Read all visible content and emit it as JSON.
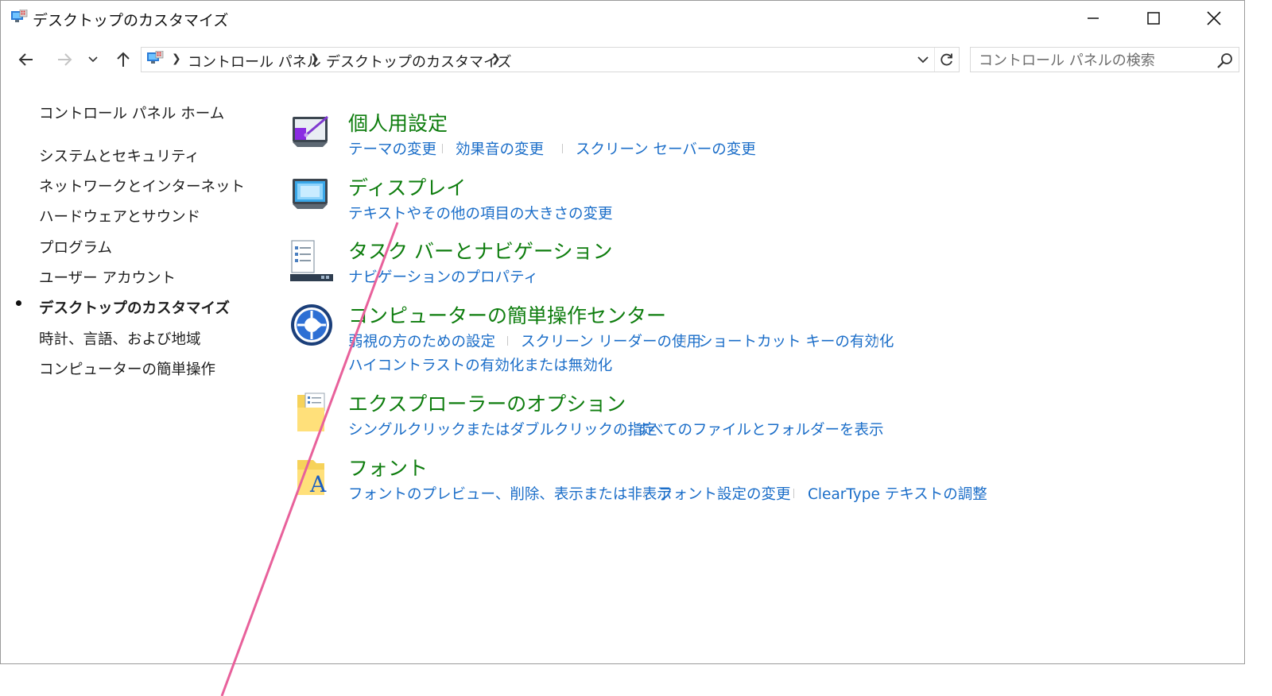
{
  "window": {
    "title": "デスクトップのカスタマイズ"
  },
  "navigation": {
    "breadcrumbs": [
      "コントロール パネル",
      "デスクトップのカスタマイズ"
    ],
    "search_placeholder": "コントロール パネルの検索"
  },
  "sidebar": {
    "items": [
      {
        "label": "コントロール パネル ホーム"
      },
      {
        "label": "システムとセキュリティ"
      },
      {
        "label": "ネットワークとインターネット"
      },
      {
        "label": "ハードウェアとサウンド"
      },
      {
        "label": "プログラム"
      },
      {
        "label": "ユーザー アカウント"
      },
      {
        "label": "デスクトップのカスタマイズ",
        "current": true
      },
      {
        "label": "時計、言語、および地域"
      },
      {
        "label": "コンピューターの簡単操作"
      }
    ]
  },
  "categories": [
    {
      "title": "個人用設定",
      "icon": "personalization-monitor-icon",
      "links": [
        "テーマの変更",
        "効果音の変更",
        "スクリーン セーバーの変更"
      ]
    },
    {
      "title": "ディスプレイ",
      "icon": "display-monitor-icon",
      "links": [
        "テキストやその他の項目の大きさの変更"
      ]
    },
    {
      "title": "タスク バーとナビゲーション",
      "icon": "taskbar-icon",
      "links": [
        "ナビゲーションのプロパティ"
      ]
    },
    {
      "title": "コンピューターの簡単操作センター",
      "icon": "ease-of-access-icon",
      "links": [
        "弱視の方のための設定",
        "スクリーン リーダーの使用",
        "ショートカット キーの有効化",
        "ハイコントラストの有効化または無効化"
      ]
    },
    {
      "title": "エクスプローラーのオプション",
      "icon": "folder-options-icon",
      "links": [
        "シングルクリックまたはダブルクリックの指定",
        "すべてのファイルとフォルダーを表示"
      ]
    },
    {
      "title": "フォント",
      "icon": "fonts-folder-icon",
      "links": [
        "フォントのプレビュー、削除、表示または非表示",
        "フォント設定の変更",
        "ClearType テキストの調整"
      ]
    }
  ],
  "colors": {
    "category_title": "#0e7d0e",
    "link": "#1a6dc8",
    "annotation_line": "#e8619b"
  }
}
